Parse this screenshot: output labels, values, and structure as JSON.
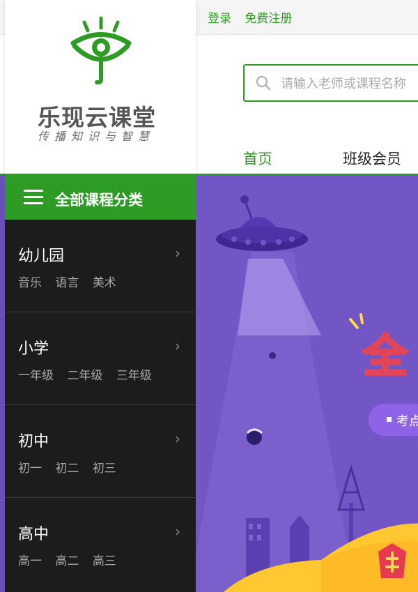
{
  "top_links": {
    "login": "登录",
    "register": "免费注册"
  },
  "logo": {
    "title": "乐现云课堂",
    "slogan": "传播知识与智慧"
  },
  "search": {
    "placeholder": "请输入老师或课程名称"
  },
  "nav": {
    "home": "首页",
    "vip": "班级会员"
  },
  "category_panel": {
    "header": "全部课程分类",
    "items": [
      {
        "name": "幼儿园",
        "subs": [
          "音乐",
          "语言",
          "美术"
        ]
      },
      {
        "name": "小学",
        "subs": [
          "一年级",
          "二年级",
          "三年级"
        ]
      },
      {
        "name": "初中",
        "subs": [
          "初一",
          "初二",
          "初三"
        ]
      },
      {
        "name": "高中",
        "subs": [
          "高一",
          "高二",
          "高三"
        ]
      }
    ],
    "arrow_icon": "chevron-right-icon"
  },
  "banner": {
    "headline_partial": "全",
    "pill_text": "考点"
  },
  "colors": {
    "brand_green": "#2e9b25",
    "sidebar_bg": "#1c1c1c",
    "banner_purple": "#7256c6"
  }
}
